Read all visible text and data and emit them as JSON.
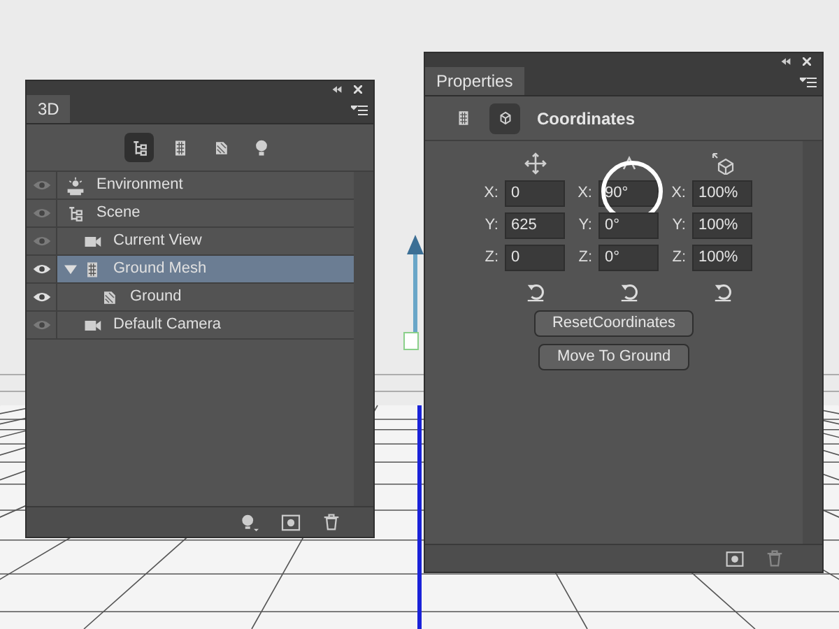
{
  "layers_panel": {
    "tab": {
      "label": "3D",
      "selected": true
    },
    "filters": [
      {
        "kind": "scene",
        "selected": true
      },
      {
        "kind": "mesh",
        "selected": false
      },
      {
        "kind": "material",
        "selected": false
      },
      {
        "kind": "light",
        "selected": false
      }
    ],
    "items": [
      {
        "kind": "environment",
        "label": "Environment",
        "visible": false,
        "selected": false
      },
      {
        "kind": "scene",
        "label": "Scene",
        "visible": false,
        "selected": false,
        "children": [
          {
            "kind": "camera",
            "label": "Current View",
            "visible": false,
            "selected": false
          },
          {
            "kind": "mesh",
            "label": "Ground Mesh",
            "visible": true,
            "selected": true,
            "expanded": true,
            "children": [
              {
                "kind": "material",
                "label": "Ground",
                "visible": true,
                "selected": false
              }
            ]
          },
          {
            "kind": "camera",
            "label": "Default Camera",
            "visible": false,
            "selected": false
          }
        ]
      }
    ]
  },
  "properties_panel": {
    "tab": {
      "label": "Properties",
      "selected": true
    },
    "modes": [
      {
        "kind": "mesh",
        "selected": false
      },
      {
        "kind": "coordinates",
        "selected": true
      }
    ],
    "title": "Coordinates",
    "groups": [
      {
        "kind": "position",
        "fields": [
          {
            "label": "X:",
            "value": "0"
          },
          {
            "label": "Y:",
            "value": "625"
          },
          {
            "label": "Z:",
            "value": "0"
          }
        ]
      },
      {
        "kind": "rotation",
        "fields": [
          {
            "label": "X:",
            "value": "90°",
            "highlighted": true
          },
          {
            "label": "Y:",
            "value": "0°"
          },
          {
            "label": "Z:",
            "value": "0°"
          }
        ]
      },
      {
        "kind": "scale",
        "fields": [
          {
            "label": "X:",
            "value": "100%"
          },
          {
            "label": "Y:",
            "value": "100%"
          },
          {
            "label": "Z:",
            "value": "100%"
          }
        ]
      }
    ],
    "buttons": [
      "ResetCoordinates",
      "Move To Ground"
    ]
  }
}
